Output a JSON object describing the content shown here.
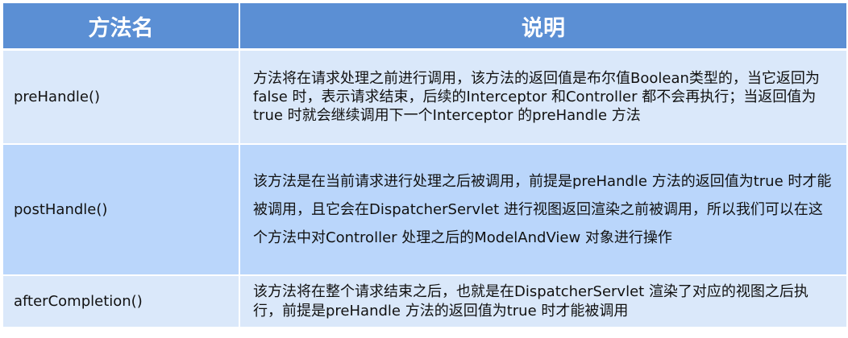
{
  "headers": {
    "name": "方法名",
    "description": "说明"
  },
  "rows": [
    {
      "name": "preHandle()",
      "description": "方法将在请求处理之前进行调用，该方法的返回值是布尔值Boolean类型的，当它返回为false 时，表示请求结束，后续的Interceptor 和Controller 都不会再执行；当返回值为true 时就会继续调用下一个Interceptor 的preHandle 方法"
    },
    {
      "name": "postHandle()",
      "description": "该方法是在当前请求进行处理之后被调用，前提是preHandle 方法的返回值为true 时才能被调用，且它会在DispatcherServlet 进行视图返回渲染之前被调用，所以我们可以在这个方法中对Controller 处理之后的ModelAndView 对象进行操作"
    },
    {
      "name": "afterCompletion()",
      "description": "该方法将在整个请求结束之后，也就是在DispatcherServlet 渲染了对应的视图之后执行，前提是preHandle 方法的返回值为true 时才能被调用"
    }
  ],
  "colors": {
    "header_bg": "#5b8fd4",
    "row_light": "#dae8fa",
    "row_mid": "#bad6fb"
  }
}
